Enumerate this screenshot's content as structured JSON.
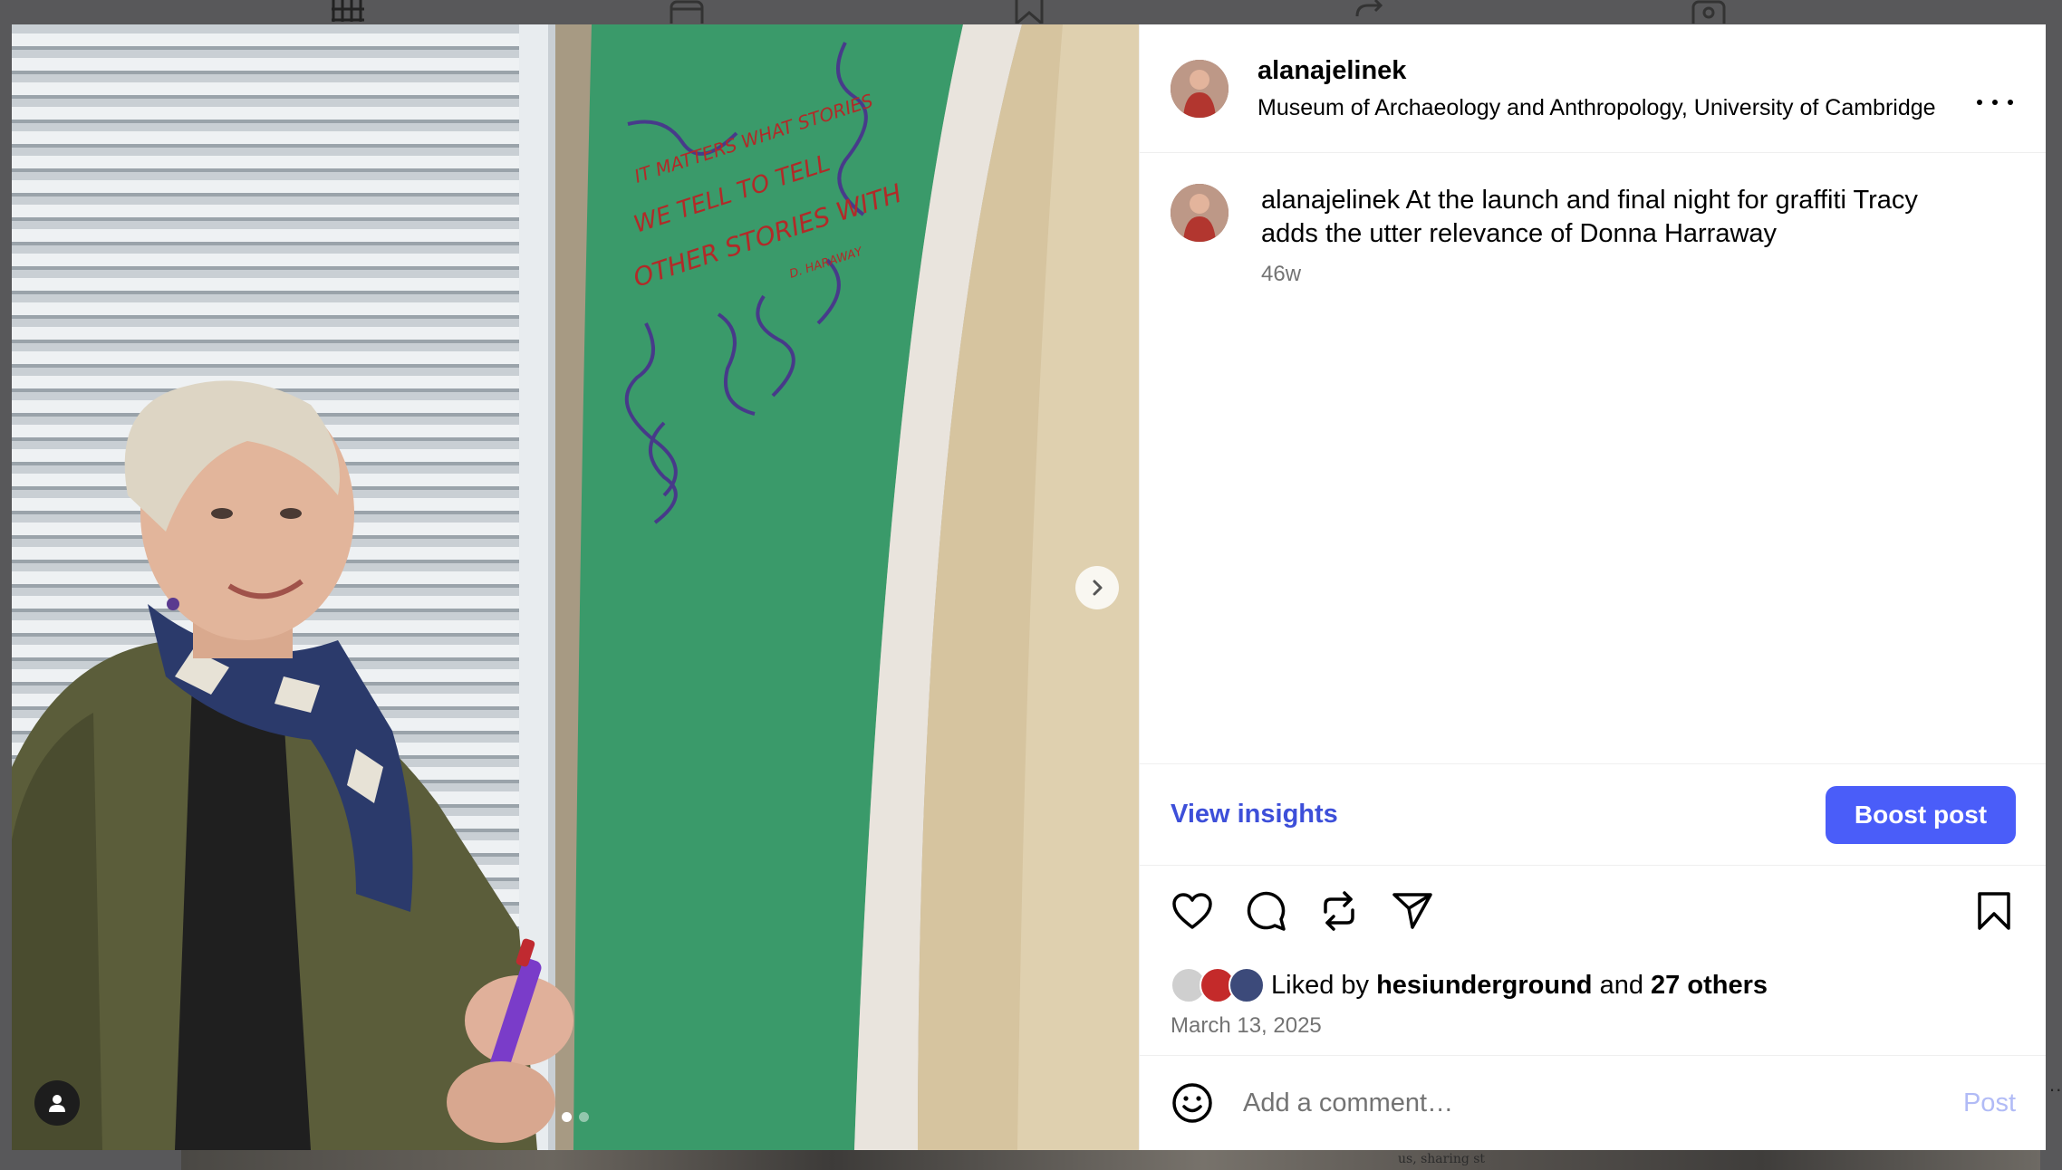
{
  "post": {
    "username": "alanajelinek",
    "location": "Museum of Archaeology and Anthropology, University of Cambridge",
    "caption": {
      "username": "alanajelinek",
      "text": "At the launch and final night for graffiti Tracy adds the utter relevance of Donna Harraway",
      "age": "46w"
    },
    "image": {
      "wall_text": [
        "IT MATTERS WHAT STORIES",
        "WE TELL TO TELL",
        "OTHER STORIES WITH",
        "D. HARAWAY"
      ],
      "carousel_count": 2,
      "carousel_index": 1
    }
  },
  "insights": {
    "view_label": "View insights",
    "boost_label": "Boost post"
  },
  "actions": {
    "icons": [
      "heart-icon",
      "comment-icon",
      "repost-icon",
      "share-icon",
      "bookmark-icon"
    ]
  },
  "likes": {
    "prefix": "Liked by",
    "top_liker": "hesiunderground",
    "conjunction": "and",
    "others": "27 others"
  },
  "date": "March 13, 2025",
  "comment": {
    "placeholder": "Add a comment…",
    "post_label": "Post"
  },
  "background": {
    "strip_text": "us, sharing st"
  },
  "colors": {
    "accent": "#4a5df9",
    "link": "#3d4fd9",
    "muted": "#737373",
    "post_disabled": "#b1bbf6",
    "wall_green": "#3a9a6a"
  }
}
